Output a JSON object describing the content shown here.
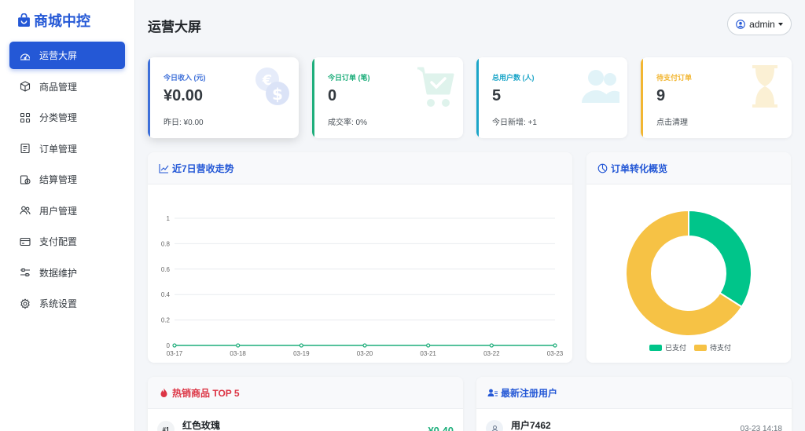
{
  "brand": {
    "name": "商城中控",
    "icon": "bag-icon",
    "color": "#2458d6"
  },
  "sidebar": {
    "items": [
      {
        "label": "运营大屏",
        "icon": "dashboard-icon",
        "active": true
      },
      {
        "label": "商品管理",
        "icon": "box-icon"
      },
      {
        "label": "分类管理",
        "icon": "grid-icon"
      },
      {
        "label": "订单管理",
        "icon": "receipt-icon"
      },
      {
        "label": "结算管理",
        "icon": "settlement-icon"
      },
      {
        "label": "用户管理",
        "icon": "users-icon"
      },
      {
        "label": "支付配置",
        "icon": "card-icon"
      },
      {
        "label": "数据维护",
        "icon": "sliders-icon"
      },
      {
        "label": "系统设置",
        "icon": "gear-icon"
      }
    ]
  },
  "header": {
    "title": "运营大屏",
    "user": "admin"
  },
  "stats": [
    {
      "label": "今日收入 (元)",
      "value": "¥0.00",
      "sub": "昨日: ¥0.00",
      "color": "#3d6fd9",
      "icon": "currency-icon"
    },
    {
      "label": "今日订单 (笔)",
      "value": "0",
      "sub": "成交率: 0%",
      "color": "#1eae7b",
      "icon": "cart-icon"
    },
    {
      "label": "总用户数 (人)",
      "value": "5",
      "sub": "今日新增: +1",
      "color": "#1ba5c8",
      "icon": "users-icon"
    },
    {
      "label": "待支付订单",
      "value": "9",
      "sub": "点击清理",
      "color": "#f2b632",
      "icon": "hourglass-icon"
    }
  ],
  "trend_panel": {
    "title": "近7日营收走势",
    "icon": "line-chart-icon"
  },
  "donut_panel": {
    "title": "订单转化概览",
    "icon": "pie-chart-icon"
  },
  "hot_panel": {
    "title": "热销商品 TOP 5",
    "icon": "fire-icon"
  },
  "users_panel": {
    "title": "最新注册用户",
    "icon": "user-add-icon"
  },
  "hot_products": [
    {
      "rank": "#1",
      "name": "红色玫瑰",
      "price": "¥0.40"
    }
  ],
  "latest_users": [
    {
      "name": "用户7462",
      "time": "03-23 14:18"
    }
  ],
  "chart_data": [
    {
      "type": "line",
      "x": [
        "03-17",
        "03-18",
        "03-19",
        "03-20",
        "03-21",
        "03-22",
        "03-23"
      ],
      "series": [
        {
          "values": [
            0,
            0,
            0,
            0,
            0,
            0,
            0
          ],
          "color": "#1eae7b"
        }
      ],
      "yticks": [
        "0",
        "0.2",
        "0.4",
        "0.6",
        "0.8",
        "1"
      ],
      "ylim": [
        0,
        1
      ],
      "grid": true
    },
    {
      "type": "pie",
      "labels": [
        "已支付",
        "待支付"
      ],
      "values": [
        34,
        66
      ],
      "colors": [
        "#00c58a",
        "#f6c245"
      ],
      "legend": "bottom"
    }
  ]
}
